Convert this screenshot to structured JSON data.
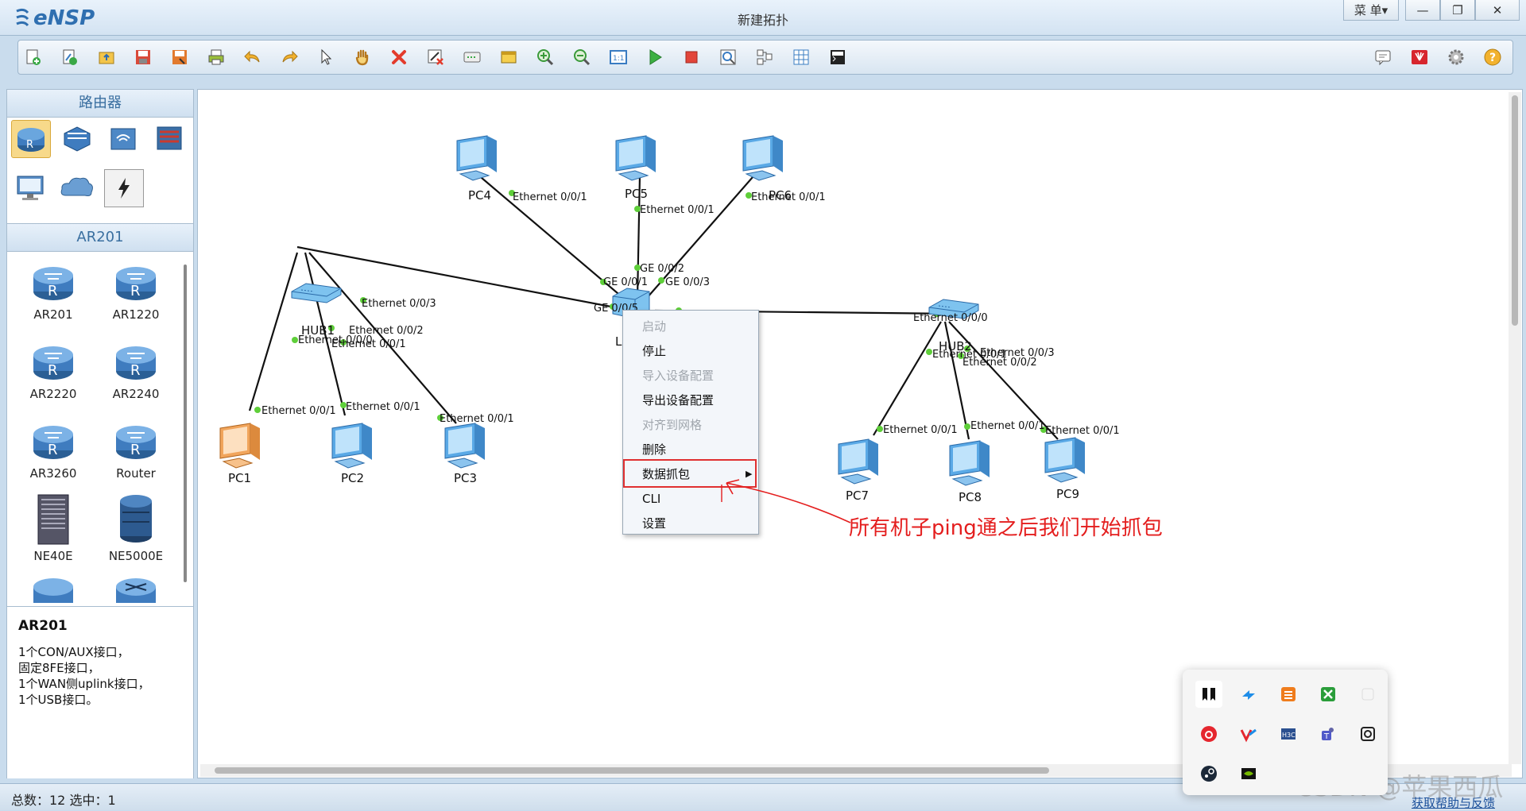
{
  "app": {
    "logo": "eNSP",
    "title": "新建拓扑"
  },
  "window_controls": {
    "menu": "菜 单▾",
    "minimize": "—",
    "restore": "❐",
    "close": "✕"
  },
  "toolbar": {
    "left_icons": [
      "new-topology-icon",
      "new-example-icon",
      "open-icon",
      "save-icon",
      "save-as-icon",
      "print-icon",
      "undo-icon",
      "redo-icon",
      "select-icon",
      "pan-hand-icon",
      "delete-icon",
      "delete-link-icon",
      "add-text-icon",
      "palette-icon",
      "zoom-in-icon",
      "zoom-out-icon",
      "fit-icon",
      "start-icon",
      "stop-icon",
      "capture-icon",
      "topology-icon",
      "grid-icon",
      "terminal-icon"
    ],
    "right_icons": [
      "chat-icon",
      "huawei-icon",
      "settings-icon",
      "help-icon"
    ]
  },
  "left_panel": {
    "category_title": "路由器",
    "categories": [
      "router-category-icon",
      "switch-category-icon",
      "wireless-category-icon",
      "firewall-category-icon",
      "pc-category-icon",
      "cloud-category-icon",
      "link-category-icon"
    ],
    "model_title": "AR201",
    "devices": [
      "AR201",
      "AR1220",
      "AR2220",
      "AR2240",
      "AR3260",
      "Router",
      "NE40E",
      "NE5000E"
    ],
    "description": {
      "title": "AR201",
      "lines": [
        "1个CON/AUX接口，",
        "固定8FE接口，",
        "1个WAN侧uplink接口，",
        "1个USB接口。"
      ]
    }
  },
  "topology": {
    "nodes": {
      "pc1": "PC1",
      "pc2": "PC2",
      "pc3": "PC3",
      "pc4": "PC4",
      "pc5": "PC5",
      "pc6": "PC6",
      "pc7": "PC7",
      "pc8": "PC8",
      "pc9": "PC9",
      "hub1": "HUB1",
      "hub2": "HUB2",
      "lsw": "L"
    },
    "ports": {
      "pc4_eth": "Ethernet 0/0/1",
      "pc5_eth": "Ethernet 0/0/1",
      "pc6_eth": "Ethernet 0/0/1",
      "lsw_ge1": "GE 0/0/1",
      "lsw_ge2": "GE 0/0/2",
      "lsw_ge3": "GE 0/0/3",
      "lsw_ge5": "GE 0/0/5",
      "hub1_eth3": "Ethernet 0/0/3",
      "hub1_eth2": "Ethernet 0/0/2",
      "hub1_eth1": "Ethernet 0/0/1",
      "hub1_eth0": "Ethernet 0/0/0",
      "pc1_eth": "Ethernet 0/0/1",
      "pc2_eth": "Ethernet 0/0/1",
      "pc3_eth": "Ethernet 0/0/1",
      "hub2_eth0": "Ethernet 0/0/0",
      "hub2_eth1": "Ethernet 0/0/1",
      "hub2_eth3": "Ethernet 0/0/3",
      "hub2_eth2": "Ethernet 0/0/2",
      "pc7_eth": "Ethernet 0/0/1",
      "pc8_eth": "Ethernet 0/0/1",
      "pc9_eth": "Ethernet 0/0/1"
    }
  },
  "context_menu": {
    "items": [
      {
        "label": "启动",
        "enabled": false
      },
      {
        "label": "停止",
        "enabled": true
      },
      {
        "label": "导入设备配置",
        "enabled": false
      },
      {
        "label": "导出设备配置",
        "enabled": true
      },
      {
        "label": "对齐到网格",
        "enabled": false
      },
      {
        "label": "删除",
        "enabled": true
      },
      {
        "label": "数据抓包",
        "enabled": true,
        "submenu": true
      },
      {
        "label": "CLI",
        "enabled": true
      },
      {
        "label": "设置",
        "enabled": true
      }
    ]
  },
  "annotation": "所有机子ping通之后我们开始抓包",
  "status_bar": {
    "text": "总数：12  选中：1",
    "help_link": "获取帮助与反馈"
  },
  "watermark": "CSDN @苹果西瓜",
  "tray_icons": [
    "notion-icon",
    "tencent-meeting-icon",
    "sublime-icon",
    "xbox-icon",
    "blank-icon",
    "netease-music-icon",
    "vmware-icon",
    "h3c-icon",
    "teams-icon",
    "capture-tool-icon",
    "steam-icon",
    "nvidia-icon"
  ]
}
